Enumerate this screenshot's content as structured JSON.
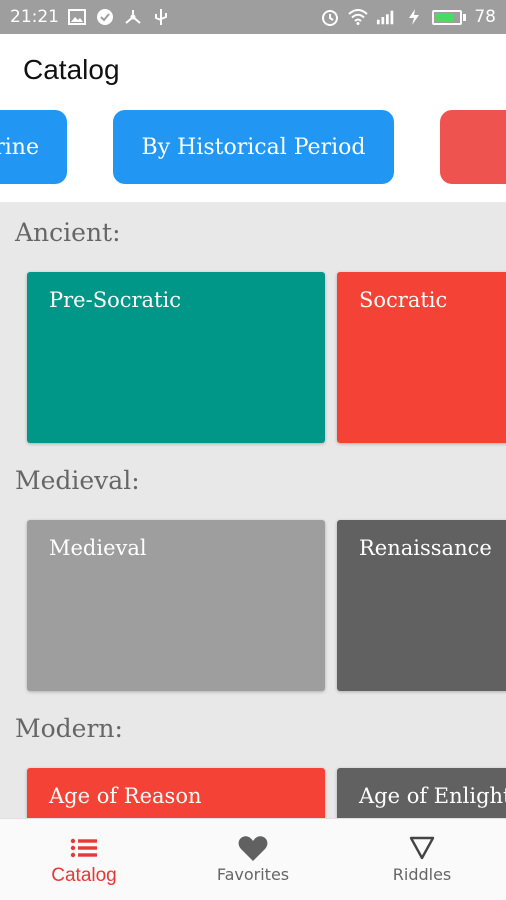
{
  "status_bar": {
    "time": "21:21",
    "battery_level": "78"
  },
  "header": {
    "title": "Catalog"
  },
  "filter_chips": [
    {
      "label": "rine",
      "color": "#2196f3"
    },
    {
      "label": "By Historical Period",
      "color": "#2196f3"
    },
    {
      "label": "",
      "color": "#ef5350"
    }
  ],
  "sections": [
    {
      "label": "Ancient:",
      "cards": [
        {
          "title": "Pre-Socratic",
          "color": "#009688"
        },
        {
          "title": "Socratic",
          "color": "#f44336"
        }
      ]
    },
    {
      "label": "Medieval:",
      "cards": [
        {
          "title": "Medieval",
          "color": "#9e9e9e"
        },
        {
          "title": "Renaissance",
          "color": "#616161"
        }
      ]
    },
    {
      "label": "Modern:",
      "cards": [
        {
          "title": "Age of Reason",
          "color": "#f44336"
        },
        {
          "title": "Age of Enlightenment",
          "color": "#616161"
        }
      ]
    }
  ],
  "bottom_nav": [
    {
      "label": "Catalog",
      "icon": "list-icon",
      "active": true
    },
    {
      "label": "Favorites",
      "icon": "heart-icon",
      "active": false
    },
    {
      "label": "Riddles",
      "icon": "triangle-icon",
      "active": false
    }
  ],
  "colors": {
    "accent": "#e53935",
    "status_bar": "#9e9e9e",
    "background": "#e8e8e8"
  }
}
